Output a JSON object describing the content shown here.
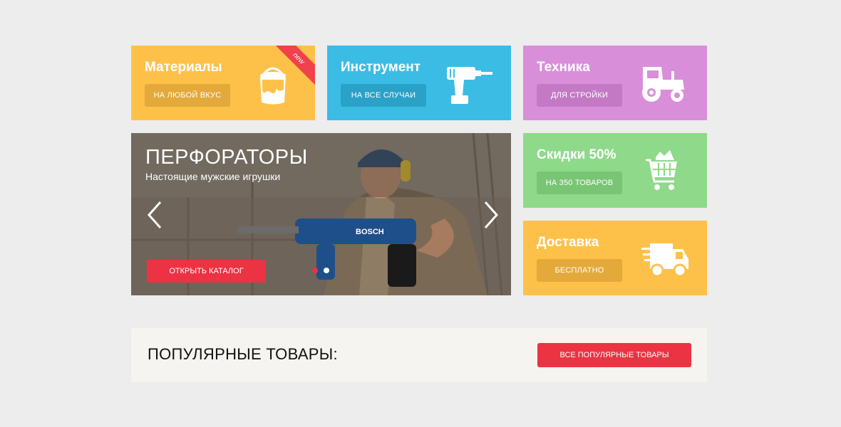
{
  "tiles": {
    "materials": {
      "title": "Материалы",
      "button": "НА ЛЮБОЙ ВКУС",
      "badge": "new",
      "icon": "paint-bucket-icon",
      "color": "#fdc14a"
    },
    "tools": {
      "title": "Инструмент",
      "button": "НА ВСЕ СЛУЧАИ",
      "icon": "drill-icon",
      "color": "#3bbce5"
    },
    "machinery": {
      "title": "Техника",
      "button": "ДЛЯ СТРОЙКИ",
      "icon": "tractor-icon",
      "color": "#d98ed9"
    },
    "discount": {
      "title": "Скидки 50%",
      "button": "НА 350 ТОВАРОВ",
      "icon": "shopping-cart-icon",
      "color": "#8ed98a"
    },
    "delivery": {
      "title": "Доставка",
      "button": "БЕСПЛАТНО",
      "icon": "delivery-truck-icon",
      "color": "#fdc14a"
    }
  },
  "banner": {
    "title": "ПЕРФОРАТОРЫ",
    "subtitle": "Настоящие мужские игрушки",
    "cta": "ОТКРЫТЬ КАТАЛОГ",
    "drill_brand": "BOSCH",
    "slides_total": 2,
    "active_slide": 1
  },
  "popular": {
    "title": "ПОПУЛЯРНЫЕ ТОВАРЫ:",
    "button": "ВСЕ ПОПУЛЯРНЫЕ ТОВАРЫ"
  },
  "colors": {
    "accent": "#ec3343",
    "background": "#ededed"
  }
}
